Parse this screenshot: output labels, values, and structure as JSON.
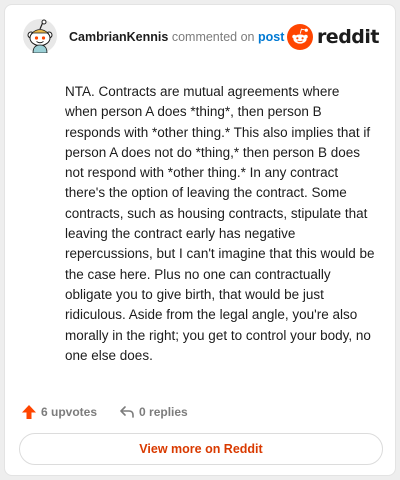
{
  "header": {
    "username": "CambrianKennis",
    "verb": "commented on",
    "post_link": "post",
    "brand_wordmark": "reddit"
  },
  "comment": {
    "text": "NTA. Contracts are mutual agreements where when person A does *thing*, then person B responds with *other thing.* This also implies that if person A does not do *thing,* then person B does not respond with *other thing.* In any contract there's the option of leaving the contract. Some contracts, such as housing contracts, stipulate that leaving the contract early has negative repercussions, but I can't imagine that this would be the case here. Plus no one can contractually obligate you to give birth, that would be just ridiculous. Aside from the legal angle, you're also morally in the right; you get to control your body, no one else does."
  },
  "actions": {
    "upvotes": "6 upvotes",
    "replies": "0 replies"
  },
  "footer": {
    "view_more": "View more on Reddit"
  },
  "icons": {
    "avatar": "snoo-avatar-icon",
    "brand": "reddit-logo-icon",
    "upvote": "upvote-arrow-icon",
    "reply": "reply-arrow-icon"
  },
  "colors": {
    "brand_orange": "#ff4500",
    "link_blue": "#0079d3",
    "cta_text": "#d93a00",
    "muted": "#7c7c7c"
  }
}
